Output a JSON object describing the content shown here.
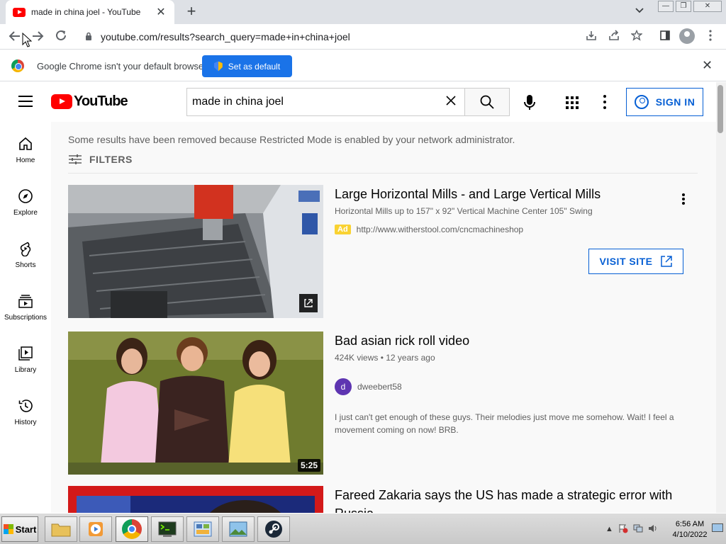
{
  "browser": {
    "tab_title": "made in china joel - YouTube",
    "tab_close": "✕",
    "new_tab": "+",
    "url": "youtube.com/results?search_query=made+in+china+joel"
  },
  "infobar": {
    "message": "Google Chrome isn't your default browser",
    "button": "Set as default",
    "close": "✕"
  },
  "youtube": {
    "logo_text": "YouTube",
    "search_value": "made in china joel",
    "sign_in": "SIGN IN",
    "guide": [
      {
        "label": "Home",
        "icon": "home-icon"
      },
      {
        "label": "Explore",
        "icon": "compass-icon"
      },
      {
        "label": "Shorts",
        "icon": "shorts-icon"
      },
      {
        "label": "Subscriptions",
        "icon": "subscriptions-icon"
      },
      {
        "label": "Library",
        "icon": "library-icon"
      },
      {
        "label": "History",
        "icon": "history-icon"
      }
    ],
    "notice": "Some results have been removed because Restricted Mode is enabled by your network administrator.",
    "filters_label": "FILTERS",
    "results": [
      {
        "title": "Large Horizontal Mills - and Large Vertical Mills",
        "subtitle": "Horizontal Mills up to 157\" x 92\" Vertical Machine Center 105\" Swing",
        "ad_badge": "Ad",
        "ad_url": "http://www.witherstool.com/cncmachineshop",
        "cta": "VISIT SITE"
      },
      {
        "title": "Bad asian rick roll video",
        "meta": "424K views • 12 years ago",
        "channel_initial": "d",
        "channel": "dweebert58",
        "description": "I just can't get enough of these guys. Their melodies just move me somehow. Wait! I feel a movement coming on now! BRB.",
        "duration": "5:25"
      },
      {
        "title": "Fareed Zakaria says the US has made a strategic error with Russia"
      }
    ]
  },
  "taskbar": {
    "start": "Start",
    "time": "6:56 AM",
    "date": "4/10/2022"
  },
  "colors": {
    "youtube_red": "#ff0000",
    "link_blue": "#065fd4",
    "chrome_blue": "#1a73e8",
    "ad_yellow": "#f9d232"
  }
}
